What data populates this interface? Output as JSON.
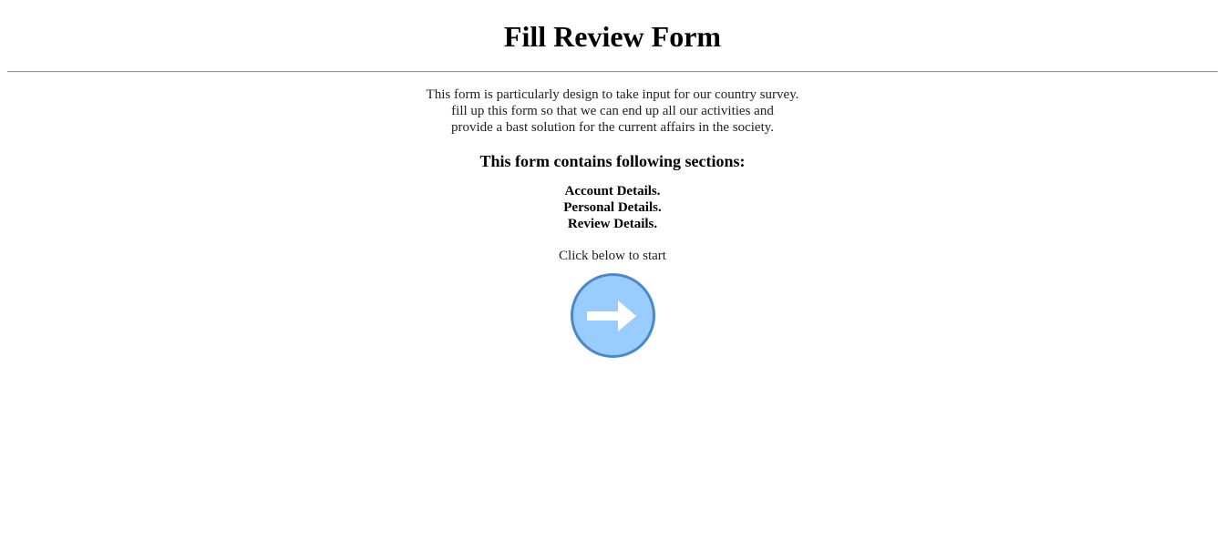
{
  "header": {
    "title": "Fill Review Form"
  },
  "intro": {
    "lines": [
      "This form is particularly design to take input for our country survey.",
      "fill up this form so that we can end up all our activities and",
      "provide a bast solution for the current affairs in the society."
    ]
  },
  "sections": {
    "heading": "This form contains following sections:",
    "items": [
      "Account Details.",
      "Personal Details.",
      "Review Details."
    ]
  },
  "cta": {
    "text": "Click below to start",
    "button_icon": "right-arrow-icon",
    "button_color": "#99ccff",
    "button_border_color": "#4a88cc"
  }
}
